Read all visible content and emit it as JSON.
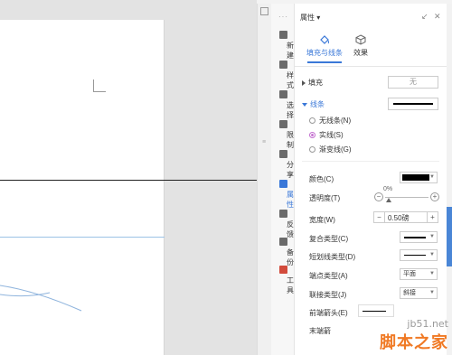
{
  "panel": {
    "title": "属性",
    "tabs": [
      {
        "label": "填充与线条",
        "icon": "paint-bucket-icon",
        "active": true
      },
      {
        "label": "效果",
        "icon": "cube-icon",
        "active": false
      }
    ],
    "fill": {
      "label": "填充",
      "value": "无"
    },
    "line": {
      "label": "线条",
      "options": [
        {
          "label": "无线条(N)",
          "checked": false
        },
        {
          "label": "实线(S)",
          "checked": true
        },
        {
          "label": "渐变线(G)",
          "checked": false
        }
      ],
      "color": {
        "label": "颜色(C)",
        "value": "#000000"
      },
      "transparency": {
        "label": "透明度(T)",
        "value": "0%"
      },
      "width": {
        "label": "宽度(W)",
        "value": "0.50磅"
      },
      "compound_type": {
        "label": "复合类型(C)"
      },
      "dash_type": {
        "label": "短划线类型(D)"
      },
      "cap_type": {
        "label": "端点类型(A)",
        "value": "平面"
      },
      "join_type": {
        "label": "联接类型(J)",
        "value": "斜接"
      },
      "begin_arrow": {
        "label": "前端箭头(E)"
      },
      "end_arrow": {
        "label": "末端箭"
      }
    }
  },
  "sidebar": {
    "items": [
      {
        "label": "新建",
        "icon": "document-icon"
      },
      {
        "label": "样式",
        "icon": "style-icon"
      },
      {
        "label": "选择",
        "icon": "select-icon"
      },
      {
        "label": "限制",
        "icon": "restrict-icon"
      },
      {
        "label": "分享",
        "icon": "share-icon"
      },
      {
        "label": "属性",
        "icon": "properties-icon",
        "active": true
      },
      {
        "label": "反馈",
        "icon": "feedback-icon"
      },
      {
        "label": "备份",
        "icon": "backup-icon"
      },
      {
        "label": "工具",
        "icon": "toolbox-icon"
      }
    ]
  },
  "watermark": {
    "site": "jb51.net",
    "name": "脚本之家"
  },
  "colors": {
    "accent": "#3a78d8",
    "radio_checked": "#c36fd0",
    "watermark": "#f07a25"
  }
}
